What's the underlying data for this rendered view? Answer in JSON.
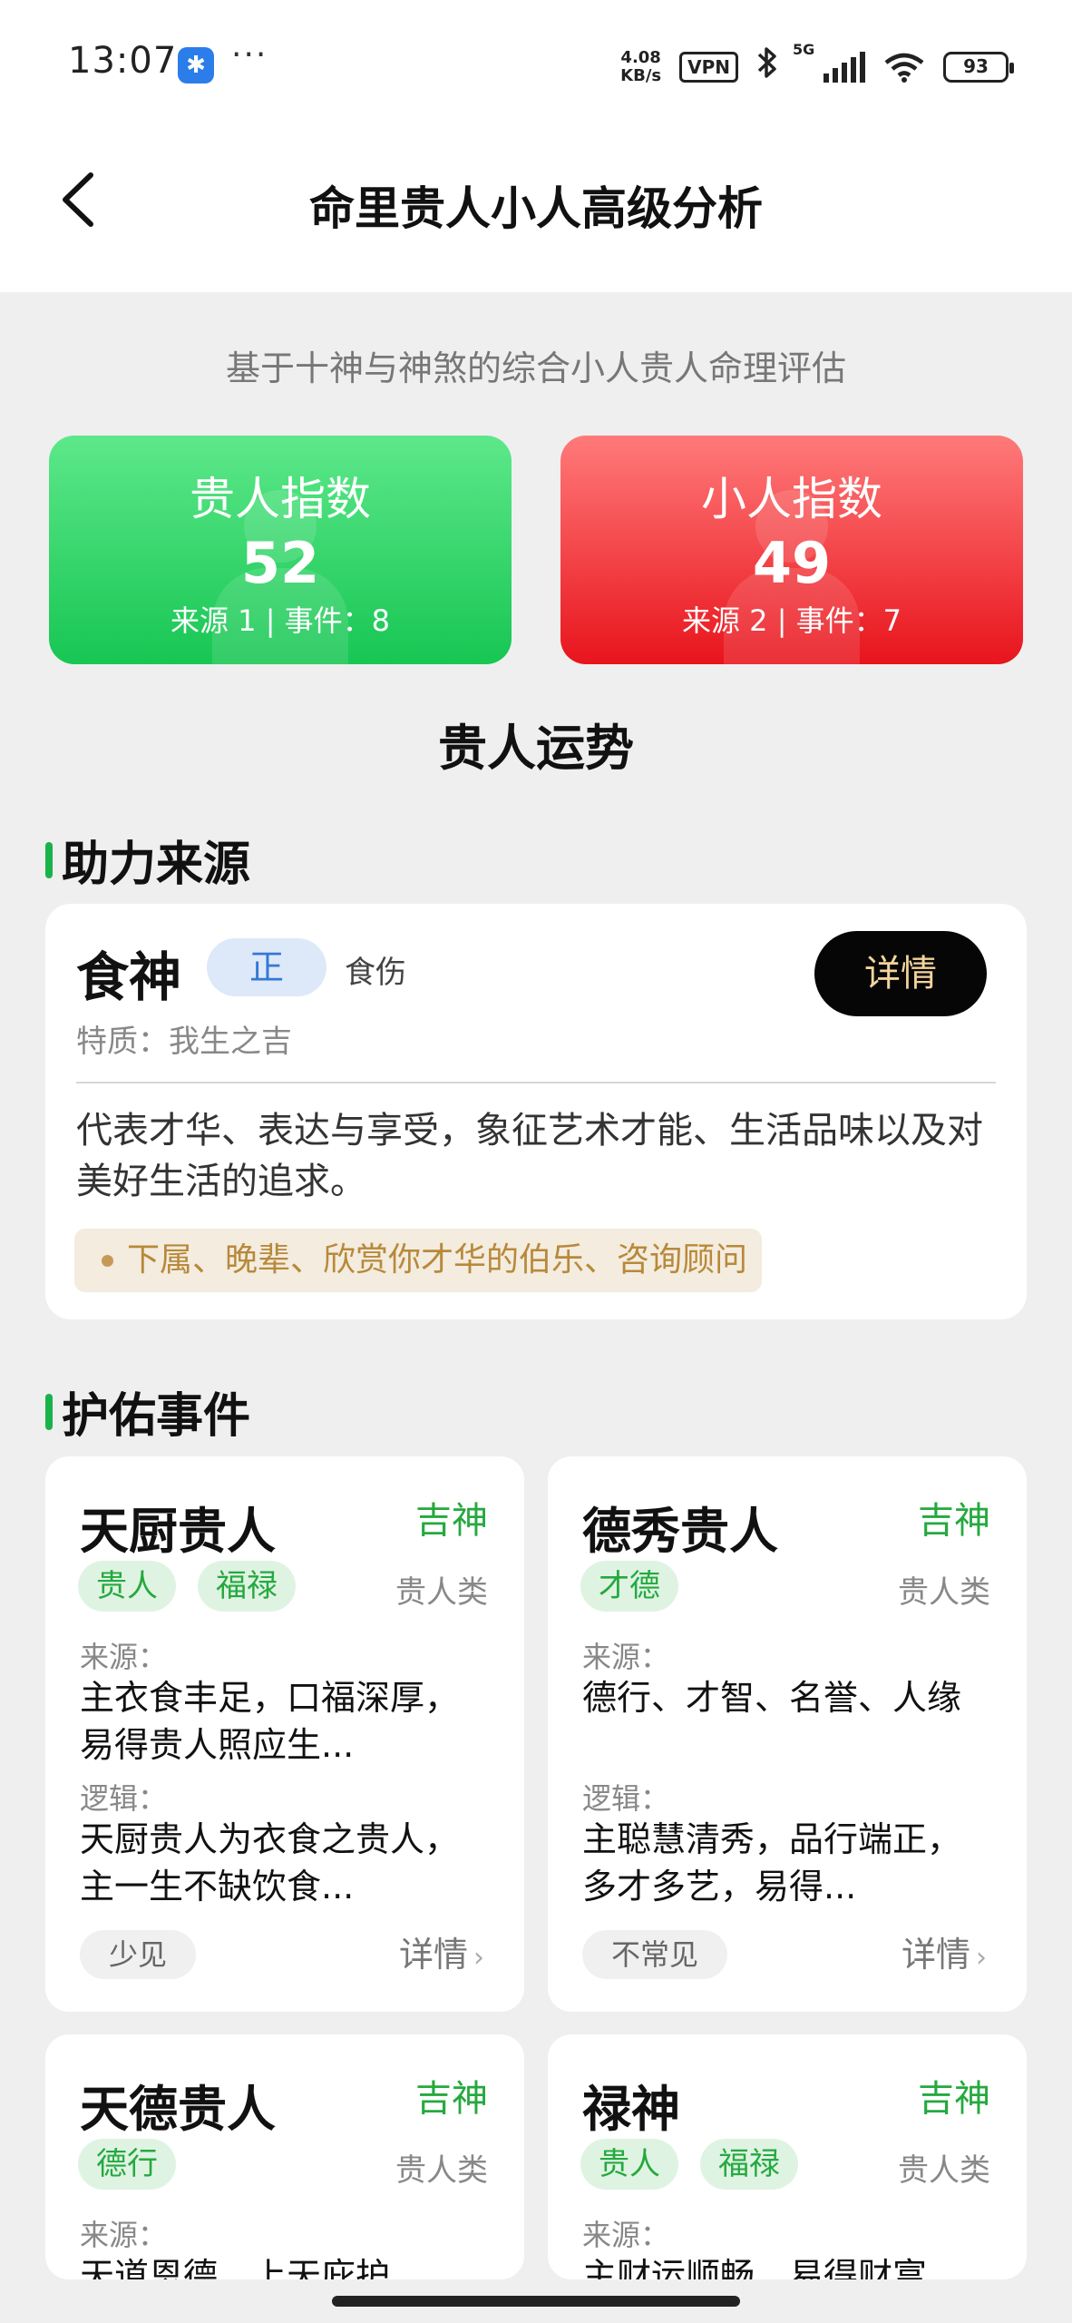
{
  "status_bar": {
    "time": "13:07",
    "dots": "···",
    "net_speed_value": "4.08",
    "net_speed_unit": "KB/s",
    "vpn": "VPN",
    "network": "5G",
    "battery": "93"
  },
  "header": {
    "title": "命里贵人小人高级分析"
  },
  "subtitle": "基于十神与神煞的综合小人贵人命理评估",
  "index_cards": {
    "noble": {
      "title": "贵人指数",
      "value": "52",
      "meta": "来源 1 | 事件：8",
      "color": "#17c653"
    },
    "villain": {
      "title": "小人指数",
      "value": "49",
      "meta": "来源 2 | 事件：7",
      "color": "#e8141c"
    }
  },
  "fortune_title": "贵人运势",
  "source_section": {
    "heading": "助力来源",
    "card": {
      "name": "食神",
      "tag": "正",
      "sub": "食伤",
      "detail_button": "详情",
      "trait": "特质：我生之吉",
      "description": "代表才华、表达与享受，象征艺术才能、生活品味以及对美好生活的追求。",
      "people": "下属、晚辈、欣赏你才华的伯乐、咨询顾问"
    }
  },
  "events_section": {
    "heading": "护佑事件",
    "source_label": "来源：",
    "logic_label": "逻辑：",
    "more_label": "详情",
    "cards": [
      {
        "name": "天厨贵人",
        "badge": "吉神",
        "tags": [
          "贵人",
          "福禄"
        ],
        "category": "贵人类",
        "source": "主衣食丰足，口福深厚，易得贵人照应生...",
        "logic": "天厨贵人为衣食之贵人，主一生不缺饮食...",
        "frequency": "少见"
      },
      {
        "name": "德秀贵人",
        "badge": "吉神",
        "tags": [
          "才德"
        ],
        "category": "贵人类",
        "source": "德行、才智、名誉、人缘",
        "logic": "主聪慧清秀，品行端正，多才多艺，易得...",
        "frequency": "不常见"
      },
      {
        "name": "天德贵人",
        "badge": "吉神",
        "tags": [
          "德行"
        ],
        "category": "贵人类",
        "source": "天道恩德，上天庇护"
      },
      {
        "name": "禄神",
        "badge": "吉神",
        "tags": [
          "贵人",
          "福禄"
        ],
        "category": "贵人类",
        "source": "主财运顺畅，易得财富"
      }
    ]
  }
}
